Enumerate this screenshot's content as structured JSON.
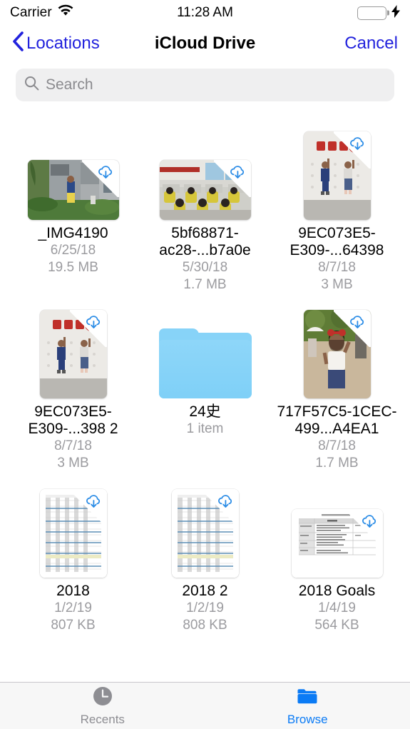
{
  "status_bar": {
    "carrier": "Carrier",
    "wifi_icon": "wifi-icon",
    "time": "11:28 AM",
    "battery_icon": "battery-icon",
    "charging_icon": "lightning-bolt-icon",
    "battery_color": "#3ad642"
  },
  "nav": {
    "back_icon": "chevron-left-icon",
    "back_label": "Locations",
    "title": "iCloud Drive",
    "cancel_label": "Cancel",
    "tint_color": "#2222dd"
  },
  "search": {
    "icon": "search-icon",
    "placeholder": "Search",
    "value": ""
  },
  "files": [
    {
      "name": "_IMG4190",
      "date": "6/25/18",
      "size": "19.5 MB",
      "kind": "photo",
      "orientation": "landscape",
      "badge_icon": "icloud-download-icon"
    },
    {
      "name": "5bf68871-ac28-...b7a0e",
      "date": "5/30/18",
      "size": "1.7 MB",
      "kind": "photo",
      "orientation": "landscape",
      "badge_icon": "icloud-download-icon"
    },
    {
      "name": "9EC073E5-E309-...64398",
      "date": "8/7/18",
      "size": "3 MB",
      "kind": "photo",
      "orientation": "portrait",
      "badge_icon": "icloud-download-icon"
    },
    {
      "name": "9EC073E5-E309-...398 2",
      "date": "8/7/18",
      "size": "3 MB",
      "kind": "photo",
      "orientation": "portrait",
      "badge_icon": "icloud-download-icon"
    },
    {
      "name": "24史",
      "date": "",
      "size": "1 item",
      "kind": "folder",
      "orientation": "",
      "badge_icon": ""
    },
    {
      "name": "717F57C5-1CEC-499...A4EA1",
      "date": "8/7/18",
      "size": "1.7 MB",
      "kind": "photo",
      "orientation": "portrait",
      "badge_icon": "icloud-download-icon"
    },
    {
      "name": "2018",
      "date": "1/2/19",
      "size": "807 KB",
      "kind": "spreadsheet",
      "orientation": "portrait",
      "badge_icon": "icloud-download-icon"
    },
    {
      "name": "2018 2",
      "date": "1/2/19",
      "size": "808 KB",
      "kind": "spreadsheet",
      "orientation": "portrait",
      "badge_icon": "icloud-download-icon"
    },
    {
      "name": "2018 Goals",
      "date": "1/4/19",
      "size": "564 KB",
      "kind": "document",
      "orientation": "landscape",
      "badge_icon": "icloud-download-icon"
    }
  ],
  "tabs": [
    {
      "label": "Recents",
      "icon": "clock-icon",
      "active": false,
      "color": "#8e8e93"
    },
    {
      "label": "Browse",
      "icon": "folder-icon",
      "active": true,
      "color": "#0b7bf5"
    }
  ]
}
